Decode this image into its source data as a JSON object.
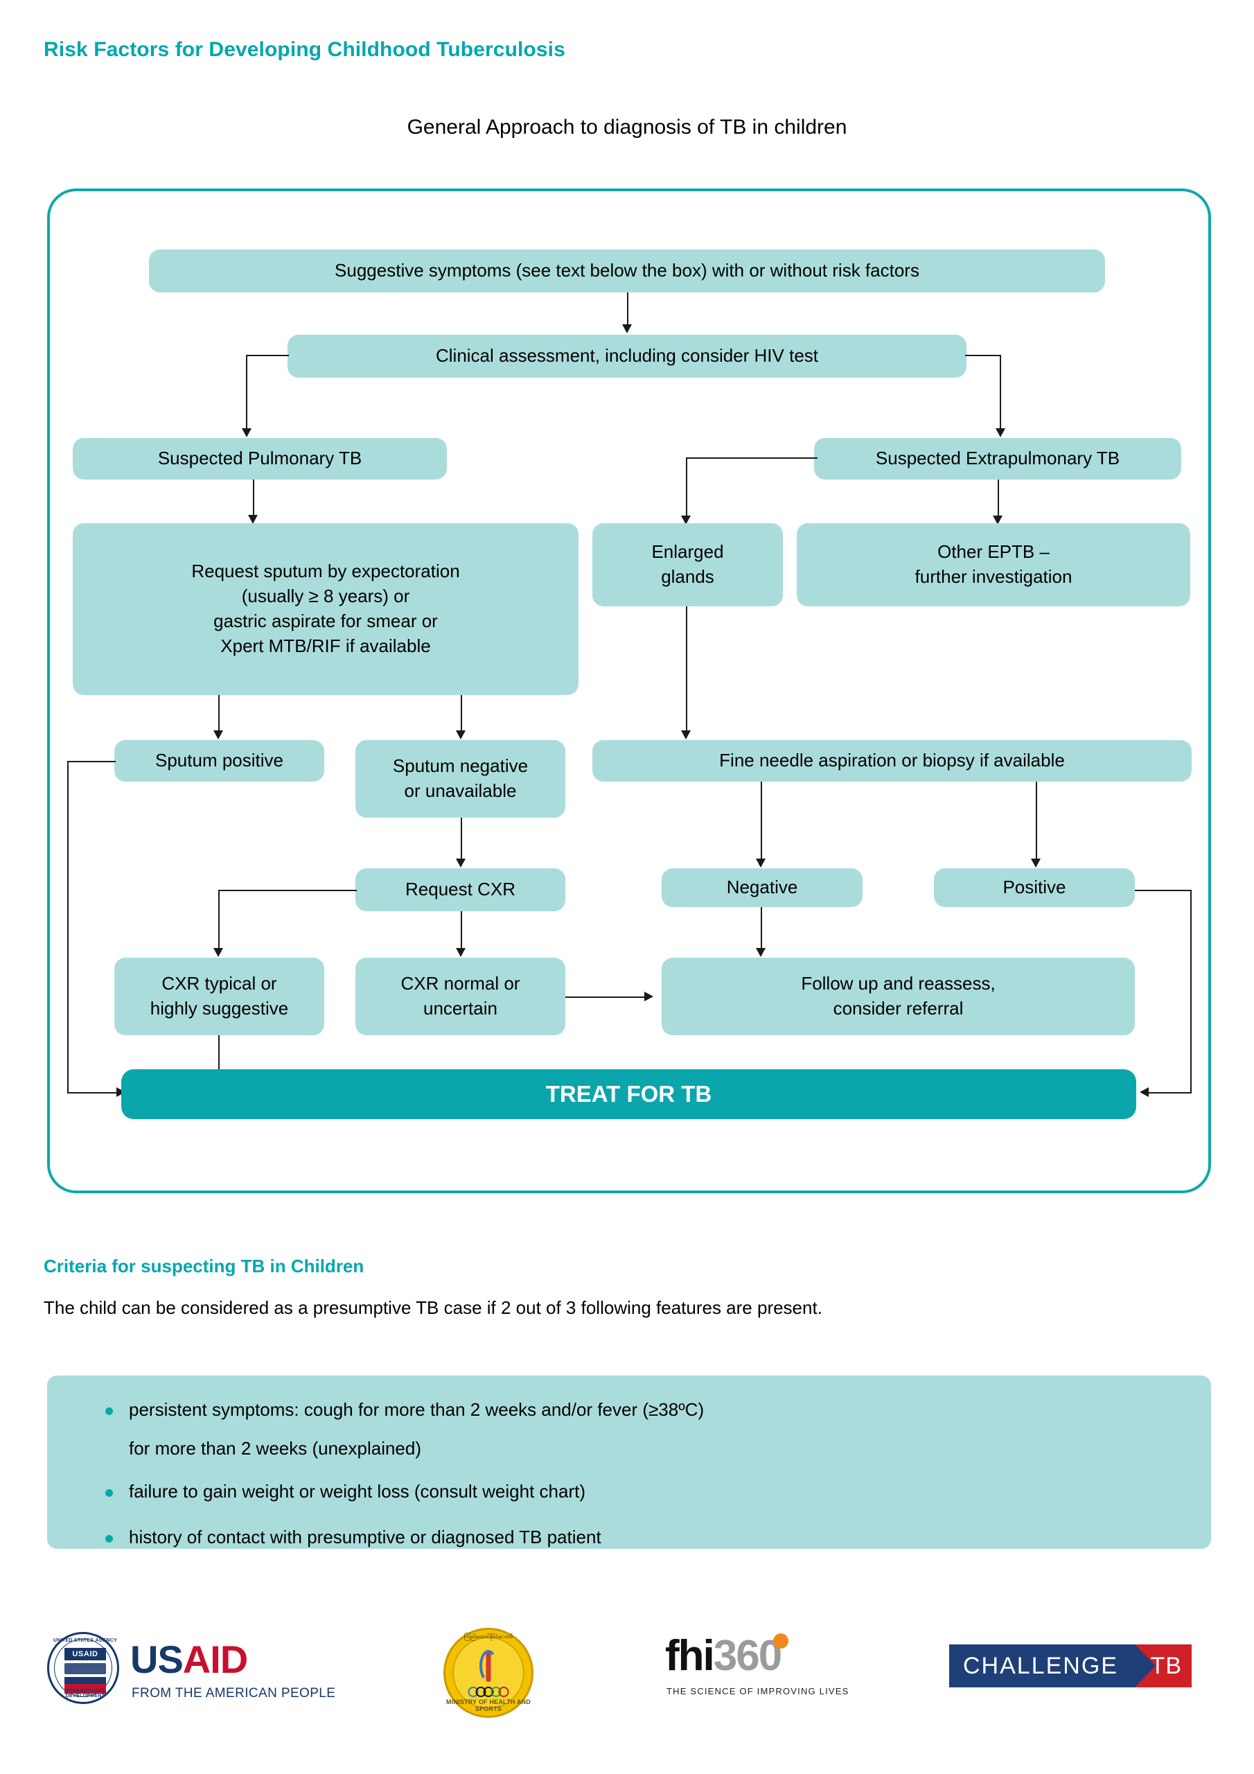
{
  "document": {
    "title": "Risk Factors for Developing Childhood Tuberculosis",
    "subtitle": "General Approach to diagnosis of TB in children"
  },
  "colors": {
    "accent_teal": "#00a7ad",
    "node_fill": "#abdcdc",
    "treat_fill": "#0aa6ac",
    "frame_border": "#0ca8ac"
  },
  "flowchart": {
    "nodes": {
      "suggestive_symptoms": "Suggestive symptoms (see text below the box) with or without risk factors",
      "clinical_assessment": "Clinical assessment, including consider HIV test",
      "suspected_pulmonary": "Suspected Pulmonary TB",
      "suspected_extrapulmonary": "Suspected Extrapulmonary TB",
      "request_sputum_l1": "Request sputum by expectoration",
      "request_sputum_l2": "(usually ≥ 8 years) or",
      "request_sputum_l3": "gastric aspirate for smear or",
      "request_sputum_l4": "Xpert MTB/RIF if available",
      "enlarged_glands_l1": "Enlarged",
      "enlarged_glands_l2": "glands",
      "other_eptb_l1": "Other EPTB –",
      "other_eptb_l2": "further investigation",
      "sputum_positive": "Sputum positive",
      "sputum_negative_l1": "Sputum negative",
      "sputum_negative_l2": "or unavailable",
      "fine_needle": "Fine needle aspiration or biopsy if available",
      "request_cxr": "Request CXR",
      "negative": "Negative",
      "positive": "Positive",
      "cxr_typical_l1": "CXR typical or",
      "cxr_typical_l2": "highly suggestive",
      "cxr_normal_l1": "CXR normal or",
      "cxr_normal_l2": "uncertain",
      "follow_up_l1": "Follow up and reassess,",
      "follow_up_l2": "consider referral",
      "treat_for_tb": "TREAT FOR TB"
    }
  },
  "criteria": {
    "title": "Criteria for suspecting TB in Children",
    "lead": "The child can be considered as a presumptive TB case if 2 out of 3 following features are present.",
    "items": [
      {
        "line1": "persistent symptoms: cough for more than 2 weeks and/or fever (≥38ºC)",
        "line2": "for more than 2 weeks (unexplained)"
      },
      {
        "line1": "failure to gain weight or weight loss (consult weight chart)",
        "line2": ""
      },
      {
        "line1": "history of contact with presumptive or diagnosed TB patient",
        "line2": ""
      }
    ]
  },
  "logos": {
    "usaid": {
      "seal_top": "UNITED STATES AGENCY",
      "seal_bottom": "INTERNATIONAL DEVELOPMENT",
      "seal_plate": "USAID",
      "word_us": "US",
      "word_aid": "AID",
      "tagline": "FROM THE AMERICAN PEOPLE"
    },
    "mohs": {
      "top_text": "ကြည်ထောင်နိုင်ငံေတာ်",
      "bottom_text": "MINISTRY OF HEALTH AND SPORTS"
    },
    "fhi": {
      "word_fhi": "fh",
      "word_i": "i",
      "word_360": "360",
      "tagline": "THE SCIENCE OF IMPROVING LIVES"
    },
    "challenge_tb": {
      "left": "CHALLENGE",
      "right": "TB"
    }
  }
}
